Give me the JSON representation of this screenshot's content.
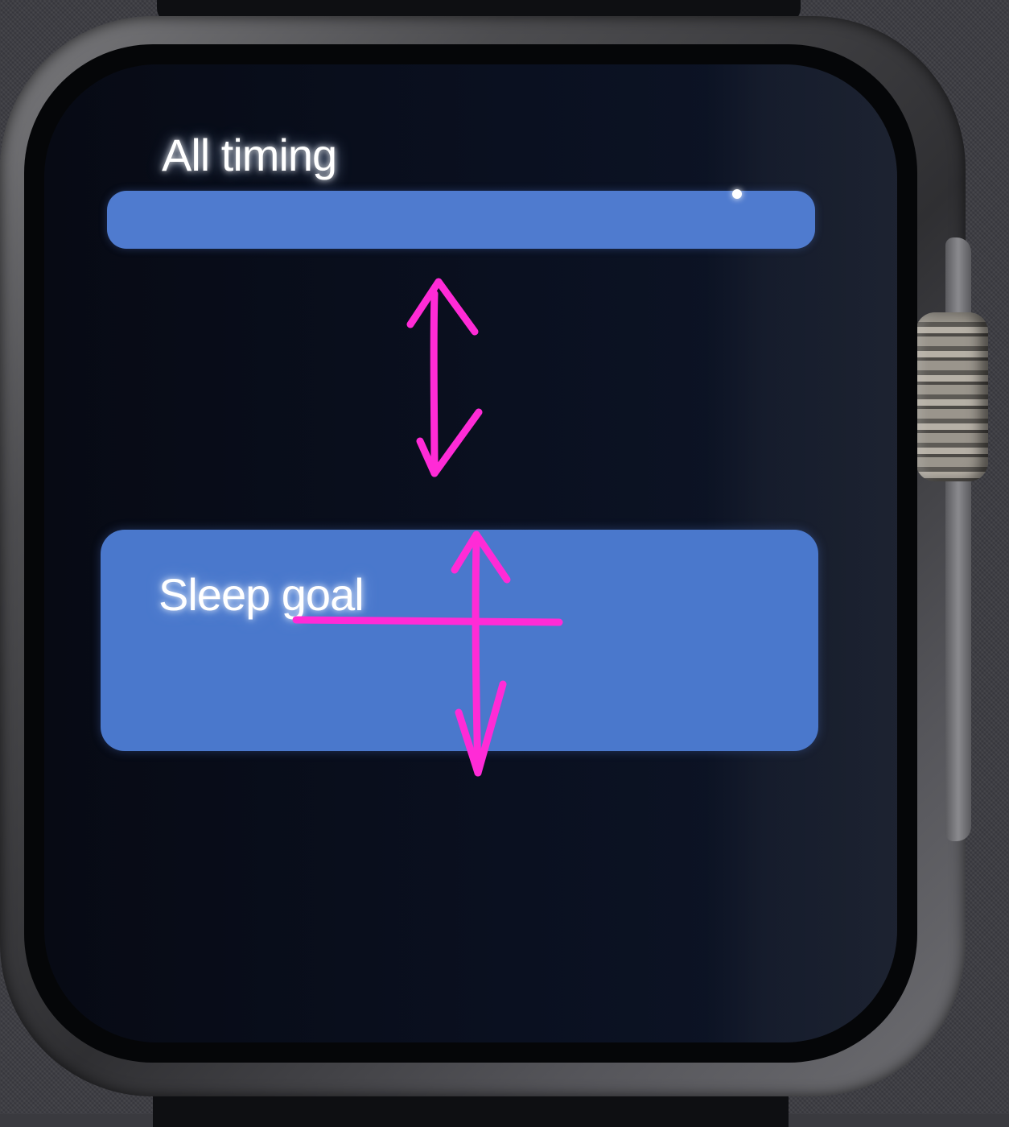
{
  "screen": {
    "title": "All timing",
    "item_2_label": "Sleep goal"
  },
  "colors": {
    "screen_bg": "#0a1020",
    "row_blue": "#4f7bcf",
    "annotation_magenta": "#ff2bd6"
  },
  "icons": {
    "scroll_hint": "double-arrow-icon"
  }
}
